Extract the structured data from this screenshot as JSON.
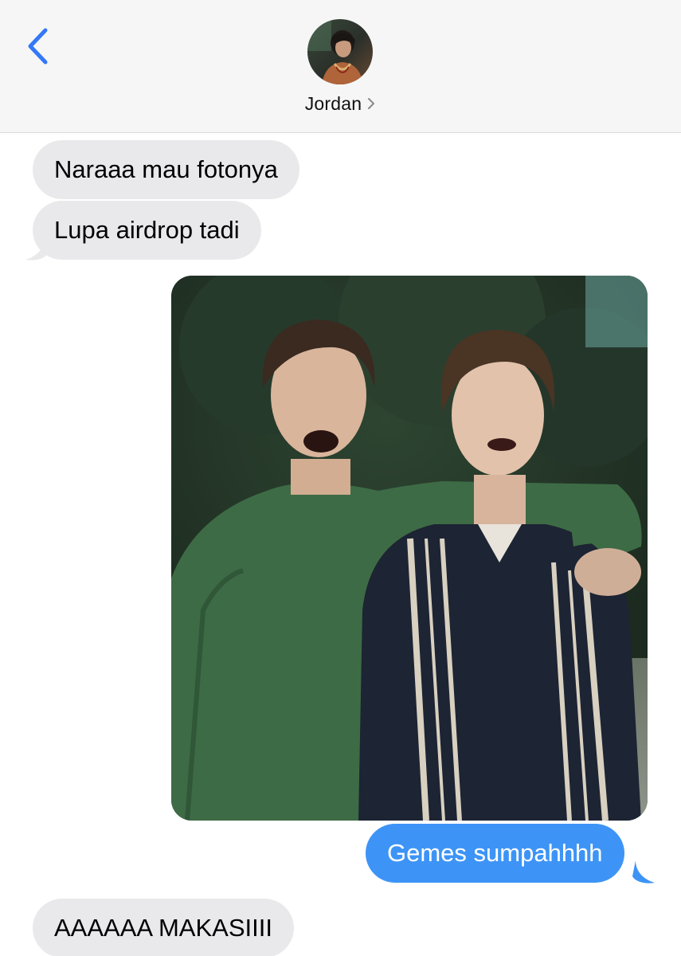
{
  "header": {
    "contact_name": "Jordan",
    "back_icon": "chevron-left-icon",
    "info_icon": "chevron-right-icon"
  },
  "messages": [
    {
      "direction": "incoming",
      "type": "text",
      "text": "Naraaa mau fotonya"
    },
    {
      "direction": "incoming",
      "type": "text",
      "text": "Lupa airdrop tadi"
    },
    {
      "direction": "outgoing",
      "type": "photo"
    },
    {
      "direction": "outgoing",
      "type": "text",
      "text": "Gemes sumpahhhh"
    },
    {
      "direction": "incoming",
      "type": "text",
      "text": "AAAAAA MAKASIIII"
    }
  ],
  "colors": {
    "accent": "#3478f6",
    "outgoing_bubble": "#3d94f6",
    "incoming_bubble": "#e9e9eb",
    "header_bg": "#f6f6f6"
  }
}
